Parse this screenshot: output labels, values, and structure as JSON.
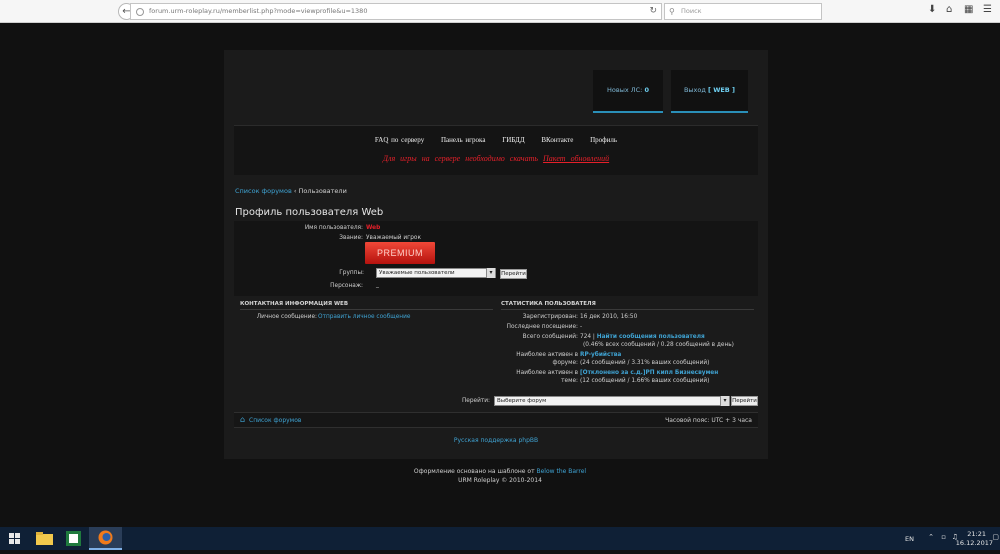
{
  "browser": {
    "url": "forum.urm-roleplay.ru/memberlist.php?mode=viewprofile&u=1380",
    "search_placeholder": "Поиск"
  },
  "top_tabs": [
    {
      "label": "Новых ЛС:",
      "value": "0"
    },
    {
      "label": "Выход",
      "value": "[ WEB ]"
    }
  ],
  "nav": {
    "items": [
      "FAQ по серверу",
      "Панель игрока",
      "ГИБДД",
      "ВКонтакте",
      "Профиль"
    ],
    "notice_text": "Для игры на сервере необходимо скачать",
    "notice_link": "Пакет обновлений"
  },
  "breadcrumb": {
    "root": "Список форумов",
    "separator": "‹",
    "current": "Пользователи"
  },
  "profile": {
    "title": "Профиль пользователя Web",
    "username_label": "Имя пользователя:",
    "username": "Web",
    "rank_label": "Звание:",
    "rank": "Уважаемый игрок",
    "badge": "PREMIUM",
    "groups_label": "Группы:",
    "group_selected": "Уважаемые пользователи",
    "go_button": "Перейти",
    "personal_label": "Персонаж:",
    "personal_value": "_"
  },
  "contact": {
    "heading": "КОНТАКТНАЯ ИНФОРМАЦИЯ WEB",
    "pm_label": "Личное сообщение:",
    "pm_link": "Отправить личное сообщение"
  },
  "stats": {
    "heading": "СТАТИСТИКА ПОЛЬЗОВАТЕЛЯ",
    "registered_label": "Зарегистрирован:",
    "registered": "16 дек 2010, 16:50",
    "last_visit_label": "Последнее посещение:",
    "last_visit": "-",
    "total_posts_label": "Всего сообщений:",
    "total_posts": "724",
    "find_posts_link": "Найти сообщения пользователя",
    "posts_share": "(0.46% всех сообщений / 0.28 сообщений в день)",
    "active_forum_label_1": "Наиболее активен в",
    "active_forum_label_2": "форуме:",
    "active_forum": "RP-убийства",
    "active_forum_detail": "(24 сообщений / 3.31% ваших сообщений)",
    "active_topic_label_1": "Наиболее активен в",
    "active_topic_label_2": "теме:",
    "active_topic": "[Отклонено за с.д.]РП кипл Бизнесвумен",
    "active_topic_detail": "(12 сообщений / 1.66% ваших сообщений)"
  },
  "jump": {
    "label": "Перейти:",
    "selected": "Выберите форум",
    "button": "Перейти"
  },
  "footer": {
    "home_link": "Список форумов",
    "timezone": "Часовой пояс: UTC + 3 часа",
    "support_link": "Русская поддержка phpBB"
  },
  "credits": {
    "line1_prefix": "Оформление основано на шаблоне от",
    "line1_link": "Below the Barrel",
    "line2": "URM Roleplay © 2010-2014"
  },
  "taskbar": {
    "lang": "EN",
    "time": "21:21",
    "date": "16.12.2017"
  },
  "colors": {
    "accent": "#3fa3d3",
    "alert": "#e5202a",
    "username": "#e5202a"
  }
}
